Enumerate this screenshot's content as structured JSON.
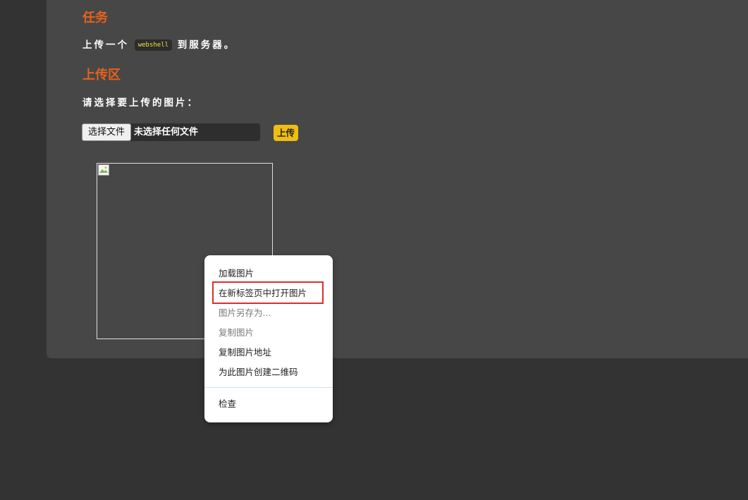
{
  "task": {
    "heading": "任务",
    "line_before": "上传一个",
    "code": "webshell",
    "line_after": "到服务器。"
  },
  "upload": {
    "heading": "上传区",
    "prompt": "请选择要上传的图片：",
    "choose_button": "选择文件",
    "no_file_text": "未选择任何文件",
    "submit_button": "上传",
    "image_icon": "broken-image-icon"
  },
  "context_menu": {
    "items": [
      {
        "label": "加载图片",
        "enabled": true
      },
      {
        "label": "在新标签页中打开图片",
        "enabled": true,
        "highlighted": true
      },
      {
        "label": "图片另存为...",
        "enabled": false
      },
      {
        "label": "复制图片",
        "enabled": false
      },
      {
        "label": "复制图片地址",
        "enabled": true
      },
      {
        "label": "为此图片创建二维码",
        "enabled": true
      },
      {
        "label": "检查",
        "enabled": true
      }
    ],
    "highlight_color": "#d9302a"
  },
  "colors": {
    "page_bg": "#333333",
    "panel_bg": "#474747",
    "heading": "#e8611a",
    "code_text": "#f2e33a",
    "upload_button": "#f0bd12"
  }
}
